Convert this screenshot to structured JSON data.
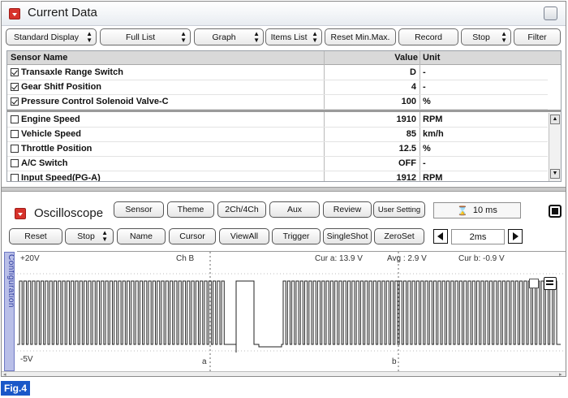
{
  "current_data": {
    "title": "Current Data",
    "toolbar": {
      "standard_display": "Standard Display",
      "full_list": "Full List",
      "graph": "Graph",
      "items_list": "Items List",
      "reset_minmax": "Reset Min.Max.",
      "record": "Record",
      "stop": "Stop",
      "filter": "Filter"
    },
    "columns": {
      "name": "Sensor Name",
      "value": "Value",
      "unit": "Unit"
    },
    "pinned_rows": [
      {
        "name": "Transaxle Range Switch",
        "value": "D",
        "unit": "-",
        "checked": true
      },
      {
        "name": "Gear Shitf Position",
        "value": "4",
        "unit": "-",
        "checked": true
      },
      {
        "name": "Pressure Control Solenoid Valve-C",
        "value": "100",
        "unit": "%",
        "checked": true
      }
    ],
    "rows": [
      {
        "name": "Engine Speed",
        "value": "1910",
        "unit": "RPM",
        "checked": false
      },
      {
        "name": "Vehicle Speed",
        "value": "85",
        "unit": "km/h",
        "checked": false
      },
      {
        "name": "Throttle Position",
        "value": "12.5",
        "unit": "%",
        "checked": false
      },
      {
        "name": "A/C Switch",
        "value": "OFF",
        "unit": "-",
        "checked": false
      },
      {
        "name": "Input Speed(PG-A)",
        "value": "1912",
        "unit": "RPM",
        "checked": false
      }
    ]
  },
  "oscilloscope": {
    "title": "Oscilloscope",
    "buttons": {
      "sensor": "Sensor",
      "theme": "Theme",
      "ch": "2Ch/4Ch",
      "aux": "Aux",
      "review": "Review",
      "user_setting": "User Setting",
      "reset": "Reset",
      "stop": "Stop",
      "name": "Name",
      "cursor": "Cursor",
      "viewall": "ViewAll",
      "trigger": "Trigger",
      "singleshot": "SingleShot",
      "zeroset": "ZeroSet"
    },
    "time_value": "10 ms",
    "time_div": "2ms",
    "config_tab": "Configuration",
    "scope": {
      "y_top": "+20V",
      "y_bottom": "-5V",
      "channel": "Ch B",
      "cur_a": "Cur a: 13.9 V",
      "avg": "Avg : 2.9 V",
      "cur_b": "Cur b: -0.9 V",
      "marker_a": "a",
      "marker_b": "b"
    }
  },
  "figure_label": "Fig.4",
  "colors": {
    "accent_red": "#d7322b",
    "fig_blue": "#1a57c8",
    "config_tab": "#b9bfe8"
  }
}
